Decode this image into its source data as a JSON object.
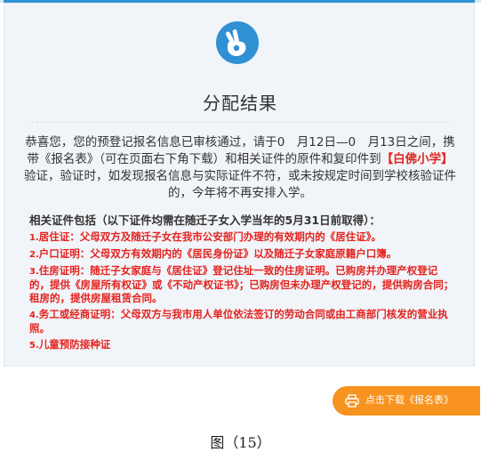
{
  "result": {
    "title": "分配结果",
    "message_pre": "恭喜您，您的预登记报名信息已审核通过，请于0　月12日—0　月13日之间，携带《报名表》（可在页面右下角下载）和相关证件的原件和复印件到",
    "school": "【白佛小学】",
    "message_post": "验证，验证时，如发现报名信息与实际证件不符，或未按规定时间到学校核验证件的，今年将不再安排入学。"
  },
  "documents": {
    "header": "相关证件包括（以下证件均需在随迁子女入学当年的5月31日前取得）：",
    "items": [
      {
        "num": "1.",
        "text": "居住证：父母双方及随迁子女在我市公安部门办理的有效期内的《居住证》。"
      },
      {
        "num": "2.",
        "text": "户口证明：父母双方有效期内的《居民身份证》以及随迁子女家庭原籍户口簿。"
      },
      {
        "num": "3.",
        "text": "住房证明：随迁子女家庭与《居住证》登记住址一致的住房证明。已购房并办理产权登记的，提供《房屋所有权证》或《不动产权证书》；已购房但未办理产权登记的，提供购房合同；租房的，提供房屋租赁合同。"
      },
      {
        "num": "4.",
        "text": "务工或经商证明：父母双方与我市用人单位依法签订的劳动合同或由工商部门核发的营业执照。"
      },
      {
        "num": "5.",
        "text": "儿童预防接种证"
      }
    ]
  },
  "download_button": {
    "label": "点击下载《报名表》",
    "icon": "printer-icon"
  },
  "logo": {
    "icon": "hand-icon"
  },
  "caption": "图（15）",
  "colors": {
    "accent": "#2f90d4",
    "highlight": "#e4231f",
    "button": "#f7931e",
    "card_bg": "#f1f4f8"
  }
}
